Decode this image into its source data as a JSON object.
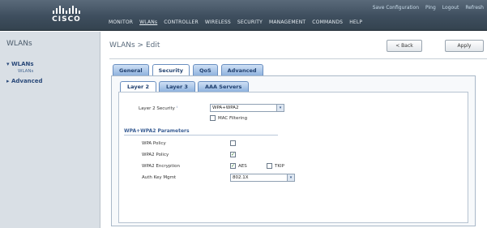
{
  "brand": {
    "name": "CISCO"
  },
  "top_links": [
    "Save Configuration",
    "Ping",
    "Logout",
    "Refresh"
  ],
  "main_nav": [
    "MONITOR",
    "WLANs",
    "CONTROLLER",
    "WIRELESS",
    "SECURITY",
    "MANAGEMENT",
    "COMMANDS",
    "HELP"
  ],
  "sidebar": {
    "title": "WLANs",
    "items": [
      {
        "label": "WLANs",
        "expander": "▾",
        "sub": "WLANs"
      },
      {
        "label": "Advanced",
        "expander": "▸"
      }
    ]
  },
  "page": {
    "title": "WLANs > Edit",
    "back_label": "< Back",
    "apply_label": "Apply"
  },
  "tabs": [
    "General",
    "Security",
    "QoS",
    "Advanced"
  ],
  "active_tab": "Security",
  "subtabs": [
    "Layer 2",
    "Layer 3",
    "AAA Servers"
  ],
  "active_subtab": "Layer 2",
  "form": {
    "layer2_security_label": "Layer 2 Security",
    "layer2_security_value": "WPA+WPA2",
    "mac_filtering_label": "MAC Filtering",
    "mac_filtering_checked": false,
    "section_title": "WPA+WPA2 Parameters",
    "wpa_policy_label": "WPA Policy",
    "wpa_policy_checked": false,
    "wpa2_policy_label": "WPA2 Policy",
    "wpa2_policy_checked": true,
    "wpa2_encryption_label": "WPA2 Encryption",
    "aes_label": "AES",
    "aes_checked": true,
    "tkip_label": "TKIP",
    "tkip_checked": false,
    "auth_key_mgmt_label": "Auth Key Mgmt",
    "auth_key_mgmt_value": "802.1X"
  },
  "icons": {
    "dropdown": "▾",
    "check": "✓",
    "info": "ⁱ"
  },
  "colors": {
    "header": "#3e4e5e",
    "tab": "#8fb2de",
    "link": "#2b4a7a"
  }
}
